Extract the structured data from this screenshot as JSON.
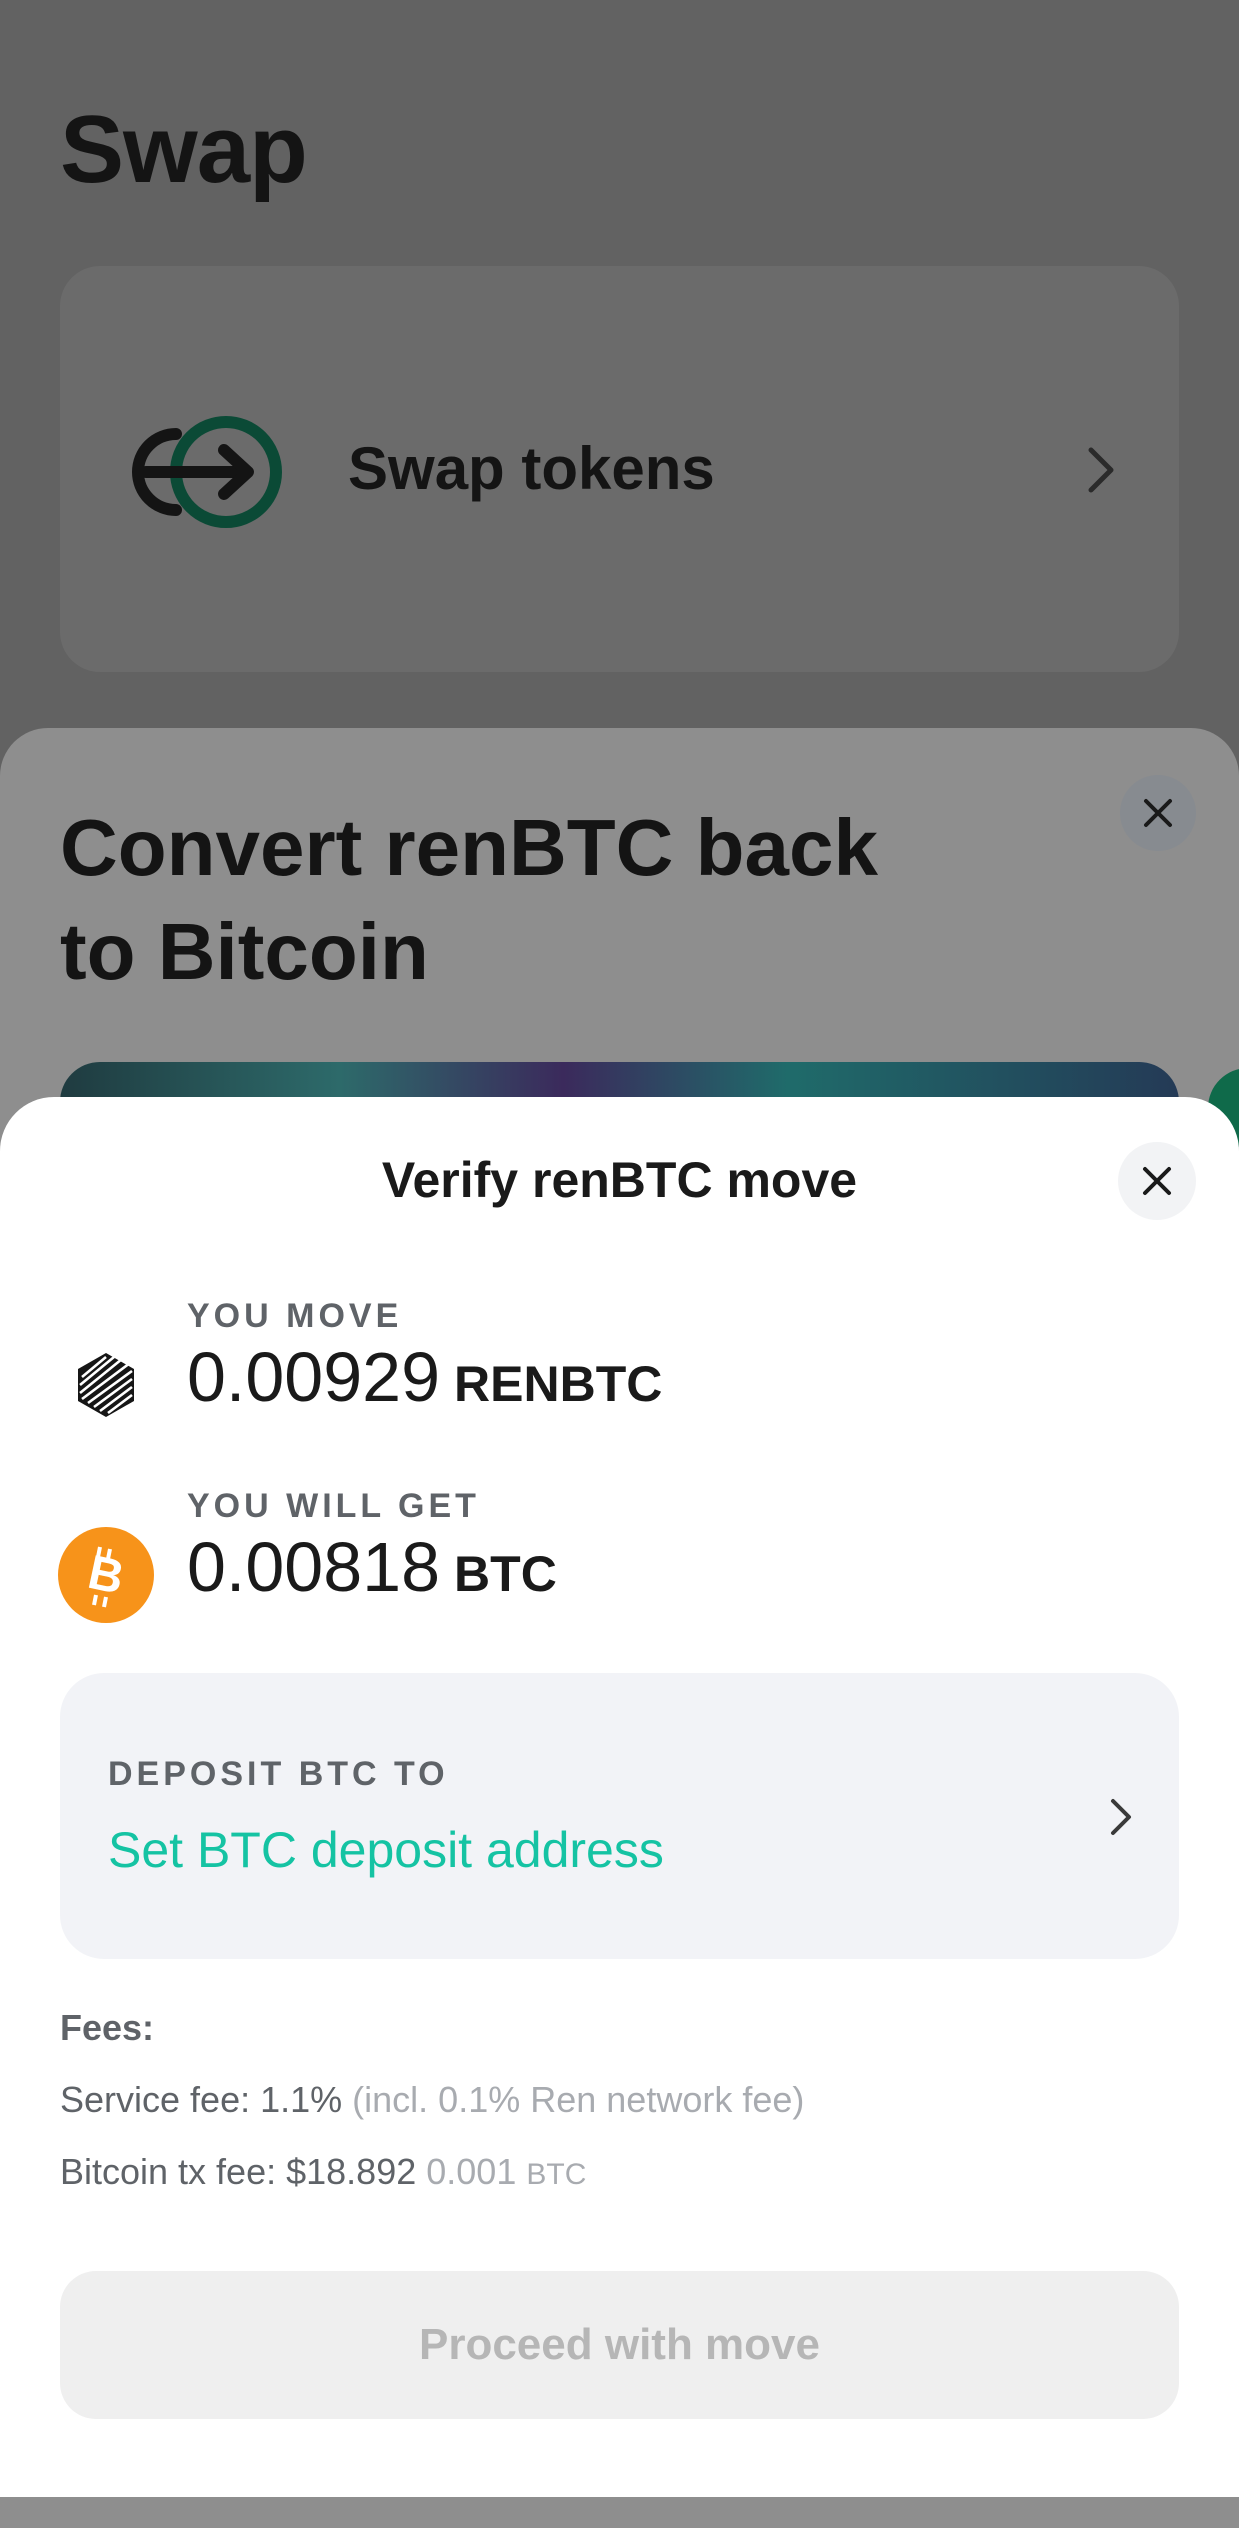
{
  "background": {
    "title": "Swap",
    "card": {
      "label": "Swap tokens",
      "icon": "swap-arrow-icon"
    },
    "accent": "#0f6a4a"
  },
  "middle_sheet": {
    "title": "Convert renBTC back to Bitcoin"
  },
  "sheet": {
    "title": "Verify renBTC move",
    "move": {
      "caption": "YOU MOVE",
      "amount": "0.00929",
      "unit": "RENBTC",
      "icon": "renbtc-token-icon"
    },
    "get": {
      "caption": "YOU WILL GET",
      "amount": "0.00818",
      "unit": "BTC",
      "icon": "bitcoin-token-icon",
      "color": "#f7931a"
    },
    "deposit": {
      "caption": "DEPOSIT BTC TO",
      "link": "Set BTC deposit address",
      "link_color": "#15c3a3"
    },
    "fees": {
      "title": "Fees:",
      "service_label": "Service fee: 1.1%",
      "service_note": "(incl. 0.1% Ren network fee)",
      "tx_label": "Bitcoin tx fee: $18.892",
      "tx_amount": "0.001",
      "tx_unit": "BTC"
    },
    "proceed_label": "Proceed with move"
  }
}
